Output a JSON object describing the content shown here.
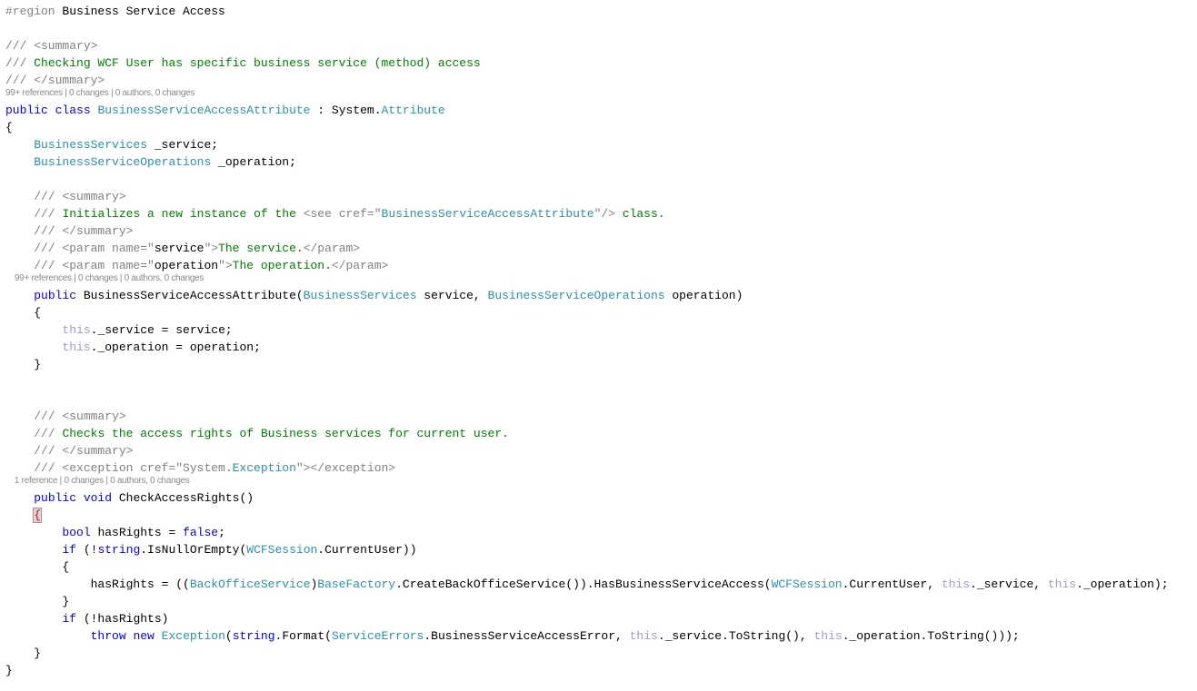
{
  "editor": {
    "region": {
      "directive": "#region",
      "name": "Business Service Access"
    },
    "class_doc": {
      "summary_open": "/// <summary>",
      "summary_prefix": "/// ",
      "summary_text": "Checking WCF User has specific business service (method) access",
      "summary_close": "/// </summary>"
    },
    "class_lens": "99+ references | 0 changes | 0 authors, 0 changes",
    "class_decl": {
      "modifiers": "public class",
      "name": "BusinessServiceAccessAttribute",
      "colon": " : System.",
      "base": "Attribute"
    },
    "open_brace": "{",
    "close_brace": "}",
    "fields": [
      {
        "type": "BusinessServices",
        "name": " _service;"
      },
      {
        "type": "BusinessServiceOperations",
        "name": " _operation;"
      }
    ],
    "ctor_doc": {
      "summary_open": "/// <summary>",
      "line2_prefix": "/// ",
      "line2_text": "Initializes a new instance of the ",
      "see_open": "<see cref=\"",
      "see_ref": "BusinessServiceAccessAttribute",
      "see_close": "\"/>",
      "line2_tail": " class.",
      "summary_close": "/// </summary>",
      "param1_open": "/// <param name=\"",
      "param1_name": "service",
      "param1_mid": "\">",
      "param1_text": "The service.",
      "param1_close": "</param>",
      "param2_open": "/// <param name=\"",
      "param2_name": "operation",
      "param2_mid": "\">",
      "param2_text": "The operation.",
      "param2_close": "</param>"
    },
    "ctor_lens": "99+ references | 0 changes | 0 authors, 0 changes",
    "ctor_decl": {
      "modifier": "public",
      "name": " BusinessServiceAccessAttribute(",
      "p1_type": "BusinessServices",
      "p1_name": " service, ",
      "p2_type": "BusinessServiceOperations",
      "p2_name": " operation)"
    },
    "ctor_body": [
      {
        "this": "this",
        "rest": "._service = service;"
      },
      {
        "this": "this",
        "rest": "._operation = operation;"
      }
    ],
    "method_doc": {
      "summary_open": "/// <summary>",
      "line2_prefix": "/// ",
      "line2_text": "Checks the access rights of Business services for current user.",
      "summary_close": "/// </summary>",
      "exc_open": "/// <exception cref=\"System.",
      "exc_ref": "Exception",
      "exc_close": "\"></exception>"
    },
    "method_lens": "1 reference | 0 changes | 0 authors, 0 changes",
    "method_decl": {
      "modifiers": "public void",
      "name": " CheckAccessRights()"
    },
    "method_body": {
      "l1_kw": "bool",
      "l1_mid": " hasRights = ",
      "l1_val": "false",
      "l1_end": ";",
      "l2_kw": "if",
      "l2_a": " (!",
      "l2_kw2": "string",
      "l2_b": ".IsNullOrEmpty(",
      "l2_ty": "WCFSession",
      "l2_c": ".CurrentUser))",
      "l4_a": "hasRights = ((",
      "l4_ty1": "BackOfficeService",
      "l4_b": ")",
      "l4_ty2": "BaseFactory",
      "l4_c": ".CreateBackOfficeService()).HasBusinessServiceAccess(",
      "l4_ty3": "WCFSession",
      "l4_d": ".CurrentUser, ",
      "l4_this1": "this",
      "l4_e": "._service, ",
      "l4_this2": "this",
      "l4_f": "._operation);",
      "l6_kw": "if",
      "l6_a": " (!hasRights)",
      "l7_kw1": "throw",
      "l7_kw2": "new",
      "l7_ty1": "Exception",
      "l7_a": "(",
      "l7_kw3": "string",
      "l7_b": ".Format(",
      "l7_ty2": "ServiceErrors",
      "l7_c": ".BusinessServiceAccessError, ",
      "l7_this1": "this",
      "l7_d": "._service.ToString(), ",
      "l7_this2": "this",
      "l7_e": "._operation.ToString()));"
    }
  }
}
